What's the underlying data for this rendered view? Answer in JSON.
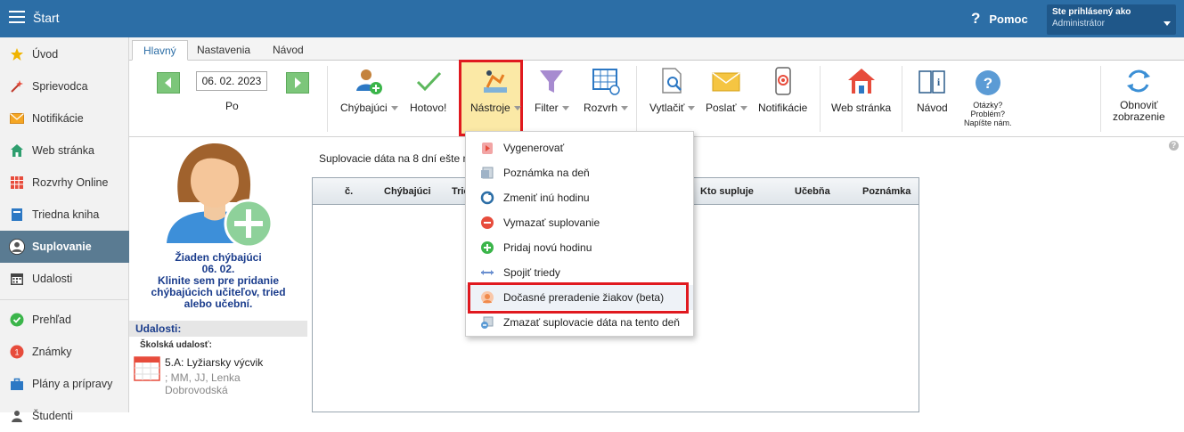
{
  "header": {
    "title": "Štart",
    "help_glyph": "?",
    "help_label": "Pomoc",
    "user_prefix": "Ste prihlásený ako",
    "user_name": "Administrátor"
  },
  "sidebar": {
    "items": [
      {
        "label": "Úvod",
        "icon": "star-icon"
      },
      {
        "label": "Sprievodca",
        "icon": "wand-icon"
      },
      {
        "label": "Notifikácie",
        "icon": "envelope-icon"
      },
      {
        "label": "Web stránka",
        "icon": "house-icon"
      },
      {
        "label": "Rozvrhy Online",
        "icon": "grid-icon"
      },
      {
        "label": "Triedna kniha",
        "icon": "book-icon"
      },
      {
        "label": "Suplovanie",
        "icon": "person-icon",
        "active": true
      },
      {
        "label": "Udalosti",
        "icon": "calendar-icon"
      },
      {
        "label": "Prehľad",
        "icon": "check-circle-icon"
      },
      {
        "label": "Známky",
        "icon": "grades-icon"
      },
      {
        "label": "Plány a prípravy",
        "icon": "briefcase-icon"
      },
      {
        "label": "Študenti",
        "icon": "students-icon"
      }
    ]
  },
  "tabs": [
    {
      "label": "Hlavný",
      "active": true
    },
    {
      "label": "Nastavenia"
    },
    {
      "label": "Návod"
    }
  ],
  "toolbar": {
    "date": "06. 02. 2023",
    "day": "Po",
    "buttons": {
      "chybajuci": "Chýbajúci",
      "hotovo": "Hotovo!",
      "nastroje": "Nástroje",
      "filter": "Filter",
      "rozvrh": "Rozvrh",
      "vytlacit": "Vytlačiť",
      "poslat": "Poslať",
      "notifikacie": "Notifikácie",
      "web": "Web stránka",
      "navod": "Návod",
      "otazky_line1": "Otázky?",
      "otazky_line2": "Problém?",
      "otazky_line3": "Napíšte nám.",
      "obnovit_line1": "Obnoviť",
      "obnovit_line2": "zobrazenie"
    }
  },
  "left_panel": {
    "no_absent_line1": "Žiaden chýbajúci",
    "no_absent_line2": "06. 02.",
    "no_absent_line3": "Klinite sem pre pridanie",
    "no_absent_line4": "chýbajúcich učiteľov, tried",
    "no_absent_line5": "alebo učební.",
    "events_title": "Udalosti:",
    "events_subtitle": "Školská udalosť:",
    "event": {
      "title": "5.A: Lyžiarsky výcvik",
      "meta": "; MM, JJ, Lenka Dobrovodská"
    }
  },
  "main": {
    "info_text": "Suplovacie dáta na 8 dní ešte n",
    "columns": [
      "č.",
      "Chýbajúci",
      "Trie",
      "Kto supluje",
      "Učebňa",
      "Poznámka"
    ]
  },
  "dropdown": {
    "items": [
      {
        "label": "Vygenerovať",
        "icon": "generate-icon"
      },
      {
        "label": "Poznámka na deň",
        "icon": "note-icon"
      },
      {
        "label": "Zmeniť inú hodinu",
        "icon": "swap-icon"
      },
      {
        "label": "Vymazať suplovanie",
        "icon": "delete-icon"
      },
      {
        "label": "Pridaj novú hodinu",
        "icon": "add-icon"
      },
      {
        "label": "Spojiť triedy",
        "icon": "merge-icon"
      },
      {
        "label": "Dočasné preradenie žiakov (beta)",
        "icon": "reassign-icon",
        "highlighted": true
      },
      {
        "label": "Zmazať suplovacie dáta na tento deň",
        "icon": "erase-icon"
      }
    ]
  },
  "colors": {
    "topbar": "#2c6ea6",
    "sidebar_active": "#5a7b92",
    "highlight_box": "#e0191f",
    "nastroje_bg": "#fbe9a6",
    "link_blue": "#1a3c8c"
  }
}
